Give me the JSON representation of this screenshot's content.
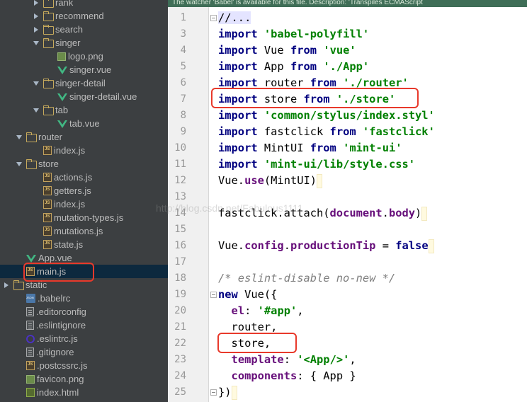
{
  "project_tree": {
    "rows": [
      {
        "label": "rank",
        "kind": "folder",
        "arrow": "closed",
        "indent": 46
      },
      {
        "label": "recommend",
        "kind": "folder",
        "arrow": "closed",
        "indent": 46
      },
      {
        "label": "search",
        "kind": "folder",
        "arrow": "closed",
        "indent": 46
      },
      {
        "label": "singer",
        "kind": "folder",
        "arrow": "open",
        "indent": 46
      },
      {
        "label": "logo.png",
        "kind": "image",
        "arrow": "",
        "indent": 66
      },
      {
        "label": "singer.vue",
        "kind": "vue",
        "arrow": "",
        "indent": 66
      },
      {
        "label": "singer-detail",
        "kind": "folder",
        "arrow": "open",
        "indent": 46
      },
      {
        "label": "singer-detail.vue",
        "kind": "vue",
        "arrow": "",
        "indent": 66
      },
      {
        "label": "tab",
        "kind": "folder",
        "arrow": "open",
        "indent": 46
      },
      {
        "label": "tab.vue",
        "kind": "vue",
        "arrow": "",
        "indent": 66
      },
      {
        "label": "router",
        "kind": "folder",
        "arrow": "open",
        "indent": 22
      },
      {
        "label": "index.js",
        "kind": "js",
        "arrow": "",
        "indent": 46
      },
      {
        "label": "store",
        "kind": "folder",
        "arrow": "open",
        "indent": 22
      },
      {
        "label": "actions.js",
        "kind": "js",
        "arrow": "",
        "indent": 46
      },
      {
        "label": "getters.js",
        "kind": "js",
        "arrow": "",
        "indent": 46
      },
      {
        "label": "index.js",
        "kind": "js",
        "arrow": "",
        "indent": 46
      },
      {
        "label": "mutation-types.js",
        "kind": "js",
        "arrow": "",
        "indent": 46
      },
      {
        "label": "mutations.js",
        "kind": "js",
        "arrow": "",
        "indent": 46
      },
      {
        "label": "state.js",
        "kind": "js",
        "arrow": "",
        "indent": 46
      },
      {
        "label": "App.vue",
        "kind": "vue",
        "arrow": "",
        "indent": 22
      },
      {
        "label": "main.js",
        "kind": "js",
        "arrow": "",
        "indent": 22,
        "selected": true
      },
      {
        "label": "static",
        "kind": "folder",
        "arrow": "closed",
        "indent": 4
      },
      {
        "label": ".babelrc",
        "kind": "json",
        "arrow": "",
        "indent": 22
      },
      {
        "label": ".editorconfig",
        "kind": "file",
        "arrow": "",
        "indent": 22
      },
      {
        "label": ".eslintignore",
        "kind": "file",
        "arrow": "",
        "indent": 22
      },
      {
        "label": ".eslintrc.js",
        "kind": "eslint",
        "arrow": "",
        "indent": 22
      },
      {
        "label": ".gitignore",
        "kind": "file",
        "arrow": "",
        "indent": 22
      },
      {
        "label": ".postcssrc.js",
        "kind": "js",
        "arrow": "",
        "indent": 22
      },
      {
        "label": "favicon.png",
        "kind": "image",
        "arrow": "",
        "indent": 22
      },
      {
        "label": "index.html",
        "kind": "html",
        "arrow": "",
        "indent": 22
      }
    ]
  },
  "editor": {
    "notice": "The watcher 'Babel' is available for this file. Description: 'Transpiles ECMAScript",
    "watermark": "http://blog.csdn.net/Fabulous1111",
    "lines": [
      {
        "n": "1",
        "fold": true,
        "tokens": [
          {
            "t": "//...",
            "c": "fold"
          }
        ]
      },
      {
        "n": "3",
        "tokens": [
          {
            "t": "import",
            "c": "kw"
          },
          {
            "t": " "
          },
          {
            "t": "'babel-polyfill'",
            "c": "str"
          }
        ]
      },
      {
        "n": "4",
        "tokens": [
          {
            "t": "import",
            "c": "kw"
          },
          {
            "t": " Vue "
          },
          {
            "t": "from",
            "c": "kw"
          },
          {
            "t": " "
          },
          {
            "t": "'vue'",
            "c": "str"
          }
        ]
      },
      {
        "n": "5",
        "tokens": [
          {
            "t": "import",
            "c": "kw"
          },
          {
            "t": " App "
          },
          {
            "t": "from",
            "c": "kw"
          },
          {
            "t": " "
          },
          {
            "t": "'./App'",
            "c": "str"
          }
        ]
      },
      {
        "n": "6",
        "tokens": [
          {
            "t": "import",
            "c": "kw"
          },
          {
            "t": " router "
          },
          {
            "t": "from",
            "c": "kw"
          },
          {
            "t": " "
          },
          {
            "t": "'./router'",
            "c": "str"
          }
        ]
      },
      {
        "n": "7",
        "tokens": [
          {
            "t": "import",
            "c": "kw"
          },
          {
            "t": " store "
          },
          {
            "t": "from",
            "c": "kw"
          },
          {
            "t": " "
          },
          {
            "t": "'./store'",
            "c": "str"
          }
        ]
      },
      {
        "n": "8",
        "tokens": [
          {
            "t": "import",
            "c": "kw"
          },
          {
            "t": " "
          },
          {
            "t": "'common/stylus/index.styl'",
            "c": "str"
          }
        ]
      },
      {
        "n": "9",
        "tokens": [
          {
            "t": "import",
            "c": "kw"
          },
          {
            "t": " fastclick "
          },
          {
            "t": "from",
            "c": "kw"
          },
          {
            "t": " "
          },
          {
            "t": "'fastclick'",
            "c": "str"
          }
        ]
      },
      {
        "n": "10",
        "tokens": [
          {
            "t": "import",
            "c": "kw"
          },
          {
            "t": " MintUI "
          },
          {
            "t": "from",
            "c": "kw"
          },
          {
            "t": " "
          },
          {
            "t": "'mint-ui'",
            "c": "str"
          }
        ]
      },
      {
        "n": "11",
        "tokens": [
          {
            "t": "import",
            "c": "kw"
          },
          {
            "t": " "
          },
          {
            "t": "'mint-ui/lib/style.css'",
            "c": "str"
          }
        ]
      },
      {
        "n": "12",
        "tokens": [
          {
            "t": "Vue."
          },
          {
            "t": "use",
            "c": "prop"
          },
          {
            "t": "(MintUI)"
          }
        ],
        "caret": true
      },
      {
        "n": "13",
        "tokens": []
      },
      {
        "n": "14",
        "tokens": [
          {
            "t": "fastclick.attach("
          },
          {
            "t": "document",
            "c": "prop"
          },
          {
            "t": "."
          },
          {
            "t": "body",
            "c": "prop"
          },
          {
            "t": ")"
          }
        ],
        "caret": true
      },
      {
        "n": "15",
        "tokens": []
      },
      {
        "n": "16",
        "tokens": [
          {
            "t": "Vue."
          },
          {
            "t": "config",
            "c": "prop"
          },
          {
            "t": "."
          },
          {
            "t": "productionTip",
            "c": "prop"
          },
          {
            "t": " = "
          },
          {
            "t": "false",
            "c": "kw"
          }
        ],
        "caret": true
      },
      {
        "n": "17",
        "tokens": []
      },
      {
        "n": "18",
        "tokens": [
          {
            "t": "/* eslint-disable no-new */",
            "c": "cmt"
          }
        ]
      },
      {
        "n": "19",
        "fold": true,
        "tokens": [
          {
            "t": "new",
            "c": "kw"
          },
          {
            "t": " Vue({"
          }
        ]
      },
      {
        "n": "20",
        "tokens": [
          {
            "t": "  "
          },
          {
            "t": "el",
            "c": "prop"
          },
          {
            "t": ": "
          },
          {
            "t": "'#app'",
            "c": "str"
          },
          {
            "t": ","
          }
        ]
      },
      {
        "n": "21",
        "tokens": [
          {
            "t": "  router,"
          }
        ]
      },
      {
        "n": "22",
        "tokens": [
          {
            "t": "  store,"
          }
        ]
      },
      {
        "n": "23",
        "tokens": [
          {
            "t": "  "
          },
          {
            "t": "template",
            "c": "prop"
          },
          {
            "t": ": "
          },
          {
            "t": "'<App/>'",
            "c": "str"
          },
          {
            "t": ","
          }
        ]
      },
      {
        "n": "24",
        "tokens": [
          {
            "t": "  "
          },
          {
            "t": "components",
            "c": "prop"
          },
          {
            "t": ": { App }"
          }
        ]
      },
      {
        "n": "25",
        "fold": true,
        "tokens": [
          {
            "t": "})"
          }
        ],
        "caret": true
      }
    ]
  },
  "colors": {
    "tree_bg": "#3c3f41",
    "selection": "#0d293e",
    "annotation": "#e8392b",
    "keyword": "#000080",
    "string": "#008000"
  }
}
